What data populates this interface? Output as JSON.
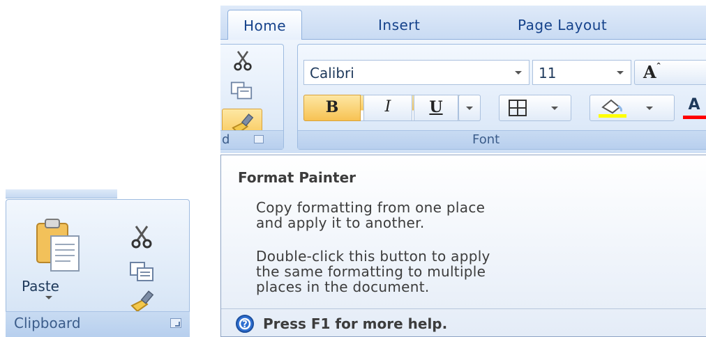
{
  "mini_clipboard": {
    "paste_label": "Paste",
    "group_label": "Clipboard"
  },
  "ribbon": {
    "tabs": [
      {
        "label": "Home",
        "active": true
      },
      {
        "label": "Insert",
        "active": false
      },
      {
        "label": "Page Layout",
        "active": false
      }
    ],
    "clipboard_slice_label": "d",
    "font_group": {
      "label": "Font",
      "font_name": "Calibri",
      "font_size": "11",
      "bold": "B",
      "italic": "I",
      "underline": "U",
      "grow_font": "A",
      "font_color_letter": "A"
    }
  },
  "tooltip": {
    "title": "Format Painter",
    "para1": "Copy formatting from one place\nand apply it to another.",
    "para2": "Double-click this button to apply\nthe same formatting to multiple\nplaces in the document.",
    "help": "Press F1 for more help."
  },
  "colors": {
    "highlight": "#ffff00",
    "font_color": "#ff0000",
    "selected": "#f9c85a"
  },
  "icons": [
    "paste-icon",
    "cut-icon",
    "copy-icon",
    "format-painter-icon",
    "borders-icon",
    "highlight-icon",
    "help-icon",
    "dialog-launcher-icon"
  ]
}
